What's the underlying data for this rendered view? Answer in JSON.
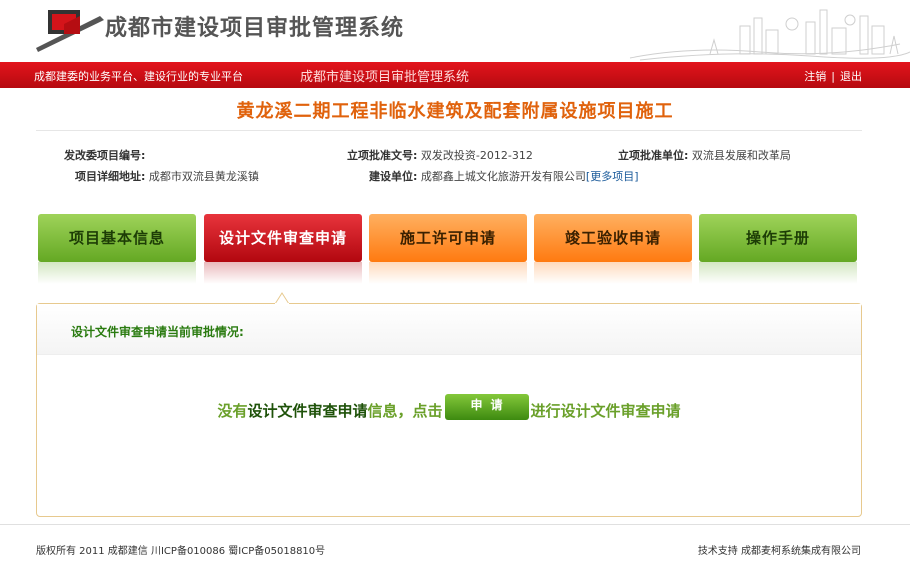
{
  "header": {
    "system_title": "成都市建设项目审批管理系统"
  },
  "top_bar": {
    "slogan": "成都建委的业务平台、建设行业的专业平台",
    "center_title": "成都市建设项目审批管理系统",
    "logout_label": "注销",
    "separator": "|",
    "exit_label": "退出"
  },
  "project": {
    "title": "黄龙溪二期工程非临水建筑及配套附属设施项目施工",
    "fields": {
      "ndrc_no_label": "发改委项目编号:",
      "ndrc_no_value": "",
      "approval_doc_label": "立项批准文号:",
      "approval_doc_value": "双发改投资-2012-312",
      "approval_unit_label": "立项批准单位:",
      "approval_unit_value": "双流县发展和改革局",
      "address_label": "项目详细地址:",
      "address_value": "成都市双流县黄龙溪镇",
      "builder_label": "建设单位:",
      "builder_value": "成都鑫上城文化旅游开发有限公司",
      "more_projects": "[更多项目]"
    }
  },
  "tabs": [
    {
      "label": "项目基本信息",
      "color": "green"
    },
    {
      "label": "设计文件审查申请",
      "color": "red"
    },
    {
      "label": "施工许可申请",
      "color": "orange"
    },
    {
      "label": "竣工验收申请",
      "color": "orange"
    },
    {
      "label": "操作手册",
      "color": "green"
    }
  ],
  "panel": {
    "section_label": "设计文件审查申请当前审批情况:",
    "msg_prefix": "没有",
    "msg_subject": "设计文件审查申请",
    "msg_mid": "信息，点击",
    "apply_button": "申请",
    "msg_suffix": "进行设计文件审查申请"
  },
  "footer": {
    "copyright": "版权所有 2011 成都建信 川ICP备010086 蜀ICP备05018810号",
    "support": "技术支持 成都麦柯系统集成有限公司"
  },
  "colors": {
    "brand_red": "#e3141c",
    "title_orange": "#e0620c",
    "green": "#64a823",
    "orange": "#ff7a10"
  }
}
